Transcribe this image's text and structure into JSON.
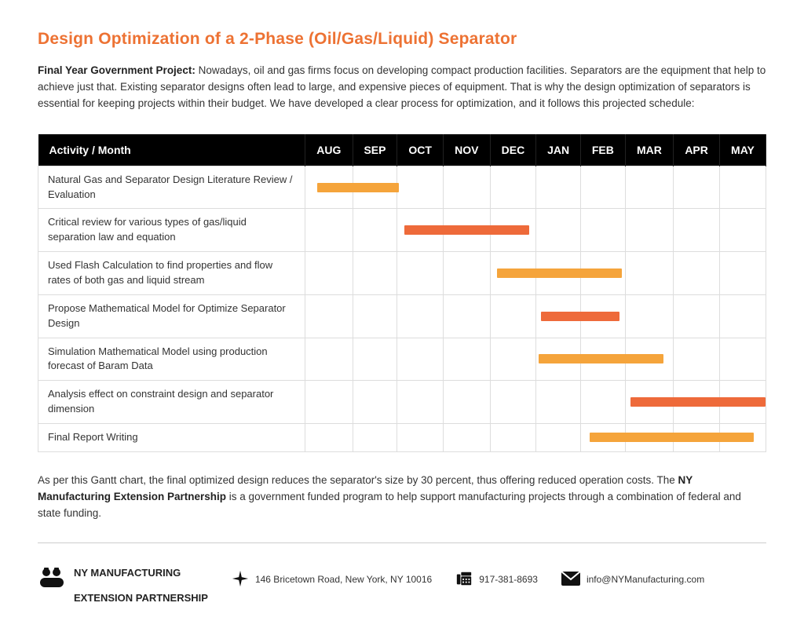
{
  "title": "Design Optimization of a 2-Phase (Oil/Gas/Liquid) Separator",
  "intro_bold": "Final Year Government Project:",
  "intro_text": " Nowadays, oil and gas firms focus on developing compact production facilities. Separators are the equipment that help to achieve just that. Existing separator designs often lead to large, and expensive pieces of equipment. That is why the design optimization of separators is essential for keeping projects within their budget. We have developed a clear process for optimization, and it follows this projected schedule:",
  "table": {
    "header_activity": "Activity / Month",
    "months": [
      "AUG",
      "SEP",
      "OCT",
      "NOV",
      "DEC",
      "JAN",
      "FEB",
      "MAR",
      "APR",
      "MAY"
    ],
    "rows": [
      "Natural Gas and Separator Design Literature Review / Evaluation",
      "Critical review for various types of gas/liquid separation law and equation",
      "Used Flash Calculation to find properties and flow rates of both gas and liquid stream",
      "Propose Mathematical Model for Optimize Separator Design",
      "Simulation Mathematical Model using production forecast of Baram Data",
      "Analysis effect on constraint design and separator dimension",
      "Final Report Writing"
    ]
  },
  "chart_data": {
    "type": "gantt",
    "x_categories": [
      "AUG",
      "SEP",
      "OCT",
      "NOV",
      "DEC",
      "JAN",
      "FEB",
      "MAR",
      "APR",
      "MAY"
    ],
    "tasks": [
      {
        "name": "Natural Gas and Separator Design Literature Review / Evaluation",
        "start": "AUG",
        "start_fraction": 0.25,
        "end": "OCT",
        "end_fraction": 0.0,
        "color": "light"
      },
      {
        "name": "Critical review for various types of gas/liquid separation law and equation",
        "start": "OCT",
        "start_fraction": 0.15,
        "end": "DEC",
        "end_fraction": 0.9,
        "color": "dark"
      },
      {
        "name": "Used Flash Calculation to find properties and flow rates of both gas and liquid stream",
        "start": "DEC",
        "start_fraction": 0.15,
        "end": "FEB",
        "end_fraction": 0.9,
        "color": "light"
      },
      {
        "name": "Propose Mathematical Model for Optimize Separator Design",
        "start": "JAN",
        "start_fraction": 0.1,
        "end": "FEB",
        "end_fraction": 0.9,
        "color": "dark"
      },
      {
        "name": "Simulation Mathematical Model using production forecast of Baram Data",
        "start": "JAN",
        "start_fraction": 0.05,
        "end": "MAR",
        "end_fraction": 0.9,
        "color": "light"
      },
      {
        "name": "Analysis effect on constraint design and separator dimension",
        "start": "MAR",
        "start_fraction": 0.1,
        "end": "MAY",
        "end_fraction": 0.95,
        "color": "dark"
      },
      {
        "name": "Final Report Writing",
        "start": "FEB",
        "start_fraction": 0.2,
        "end": "MAY",
        "end_fraction": 0.95,
        "color": "light"
      }
    ],
    "colors": {
      "light": "#f5a43b",
      "dark": "#ee6a3a"
    }
  },
  "outro_pre": "As per this Gantt chart, the final optimized design reduces the separator's size by 30 percent, thus offering reduced operation costs. The ",
  "outro_bold": "NY Manufacturing Extension Partnership",
  "outro_post": " is a government funded program to help support manufacturing projects through a combination of federal and state funding.",
  "footer": {
    "org_line1": "NY MANUFACTURING",
    "org_line2": "EXTENSION PARTNERSHIP",
    "address": "146 Bricetown Road, New York, NY 10016",
    "phone": "917-381-8693",
    "email": "info@NYManufacturing.com"
  }
}
